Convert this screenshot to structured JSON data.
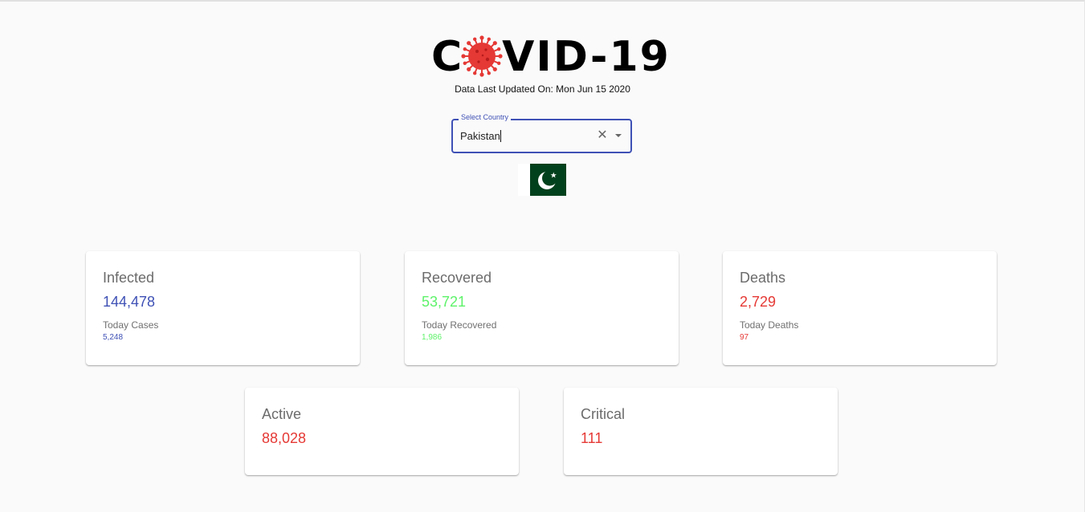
{
  "header": {
    "logo_left": "C",
    "logo_right": "VID-19",
    "updated_text": "Data Last Updated On: Mon Jun 15 2020"
  },
  "country_select": {
    "label": "Select Country",
    "value": "Pakistan",
    "clear_icon": "close-icon",
    "dropdown_icon": "caret-down-icon"
  },
  "flag": {
    "country": "Pakistan",
    "icon": "pakistan-flag-icon"
  },
  "colors": {
    "infected": "#3f51b5",
    "recovered": "#5ef26a",
    "deaths": "#e53935",
    "active": "#e53935",
    "critical": "#e53935",
    "accent": "#3f51b5"
  },
  "cards": {
    "infected": {
      "title": "Infected",
      "value": "144,478",
      "sub_label": "Today Cases",
      "sub_value": "5,248"
    },
    "recovered": {
      "title": "Recovered",
      "value": "53,721",
      "sub_label": "Today Recovered",
      "sub_value": "1,986"
    },
    "deaths": {
      "title": "Deaths",
      "value": "2,729",
      "sub_label": "Today Deaths",
      "sub_value": "97"
    },
    "active": {
      "title": "Active",
      "value": "88,028"
    },
    "critical": {
      "title": "Critical",
      "value": "111"
    }
  }
}
